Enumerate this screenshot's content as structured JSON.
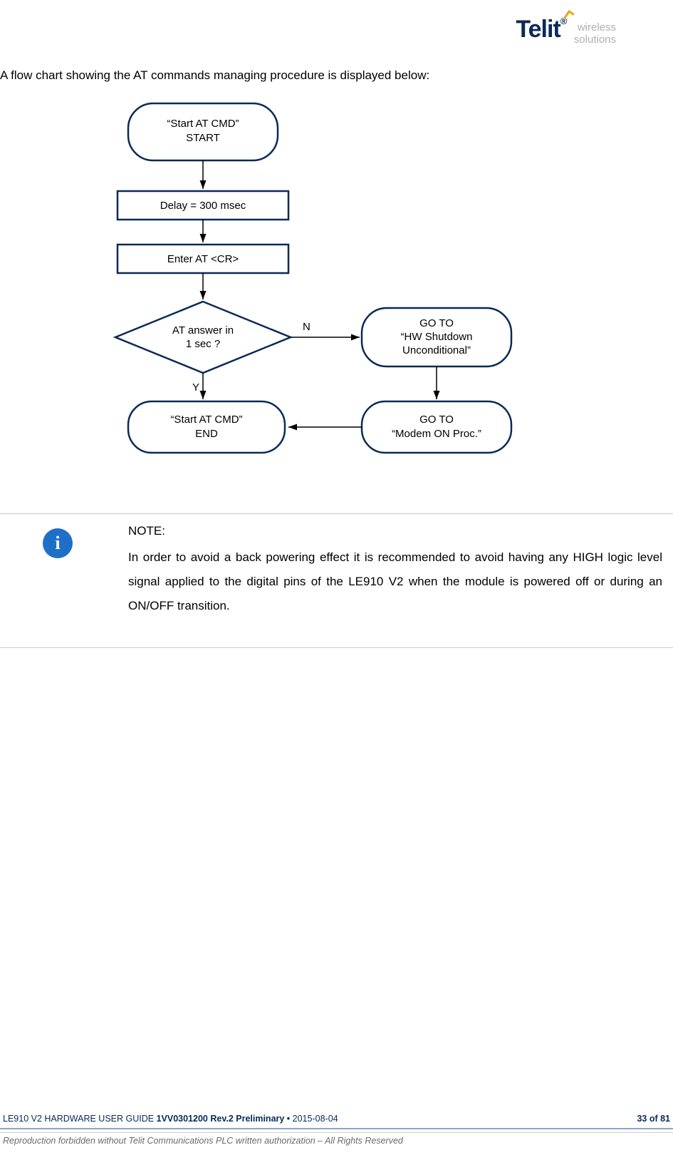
{
  "header": {
    "brand": "Telit",
    "sub1": "wireless",
    "sub2": "solutions"
  },
  "intro": "A flow chart showing the AT commands managing procedure is displayed below:",
  "chart_data": {
    "type": "flowchart",
    "nodes": [
      {
        "id": "start",
        "kind": "terminator",
        "line1": "“Start AT CMD”",
        "line2": "START"
      },
      {
        "id": "delay",
        "kind": "process",
        "line1": "Delay = 300 msec"
      },
      {
        "id": "enter",
        "kind": "process",
        "line1": "Enter AT <CR>"
      },
      {
        "id": "decision",
        "kind": "decision",
        "line1": "AT answer in",
        "line2": "1 sec ?"
      },
      {
        "id": "hwshut",
        "kind": "terminator",
        "line1": "GO TO",
        "line2": "“HW Shutdown",
        "line3": "Unconditional”"
      },
      {
        "id": "modemon",
        "kind": "terminator",
        "line1": "GO TO",
        "line2": "“Modem ON Proc.”"
      },
      {
        "id": "end",
        "kind": "terminator",
        "line1": "“Start AT CMD”",
        "line2": "END"
      }
    ],
    "edges": [
      {
        "from": "start",
        "to": "delay"
      },
      {
        "from": "delay",
        "to": "enter"
      },
      {
        "from": "enter",
        "to": "decision"
      },
      {
        "from": "decision",
        "to": "hwshut",
        "label": "N"
      },
      {
        "from": "decision",
        "to": "end",
        "label": "Y"
      },
      {
        "from": "hwshut",
        "to": "modemon"
      },
      {
        "from": "modemon",
        "to": "end"
      }
    ],
    "labels": {
      "N": "N",
      "Y": "Y"
    }
  },
  "note": {
    "icon": "i",
    "title": "NOTE:",
    "body": "In order to avoid a back powering effect it is recommended to avoid having any HIGH logic level signal applied to the digital pins of the LE910 V2 when the module is powered off or during an ON/OFF transition."
  },
  "footer": {
    "left_prefix": "LE910 V2 HARDWARE USER GUIDE ",
    "left_bold": "1VV0301200 Rev.2 Preliminary • ",
    "left_suffix": "2015-08-04",
    "right": "33 of 81",
    "line2": "Reproduction forbidden without Telit Communications PLC written authorization – All Rights Reserved"
  }
}
